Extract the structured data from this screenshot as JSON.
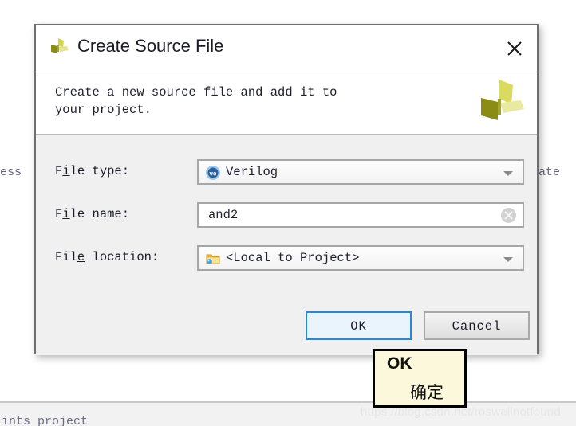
{
  "background": {
    "text_left_clipped": "Press",
    "text_right_clipped": "eate",
    "text_bottom_clipped": "ints project",
    "watermark": "https://blog.csdn.net/roswellnotfound"
  },
  "dialog": {
    "title": "Create Source File",
    "title_icon": "xilinx-logo-icon",
    "close_icon": "close-icon",
    "header_logo_icon": "xilinx-logo-large-icon",
    "description": "Create a new source file and add it to\nyour project.",
    "fields": [
      {
        "label_before": "F",
        "label_mnemonic": "i",
        "label_after": "le type:",
        "label_full": "File type:",
        "value": "Verilog",
        "icon": "verilog-file-icon",
        "control": "combobox"
      },
      {
        "label_before": "F",
        "label_mnemonic": "i",
        "label_after": "le name:",
        "label_full": "File name:",
        "value": "and2",
        "icon": "clear-icon",
        "control": "textbox"
      },
      {
        "label_before": "Fil",
        "label_mnemonic": "e",
        "label_after": " location:",
        "label_full": "File location:",
        "value": "<Local to Project>",
        "icon": "folder-icon",
        "control": "combobox"
      }
    ],
    "buttons": {
      "ok": "OK",
      "cancel": "Cancel"
    }
  },
  "annotation": {
    "english": "OK",
    "chinese": "确定"
  },
  "colors": {
    "dialog_bg": "#f0f0f0",
    "dialog_border": "#6e6e6e",
    "ok_accent": "#1f8ae0",
    "ok_fill": "#eaf4fd",
    "annotation_bg": "#fbf8dc",
    "logo_olive": "#9a9b22",
    "logo_light": "#d9da79"
  }
}
